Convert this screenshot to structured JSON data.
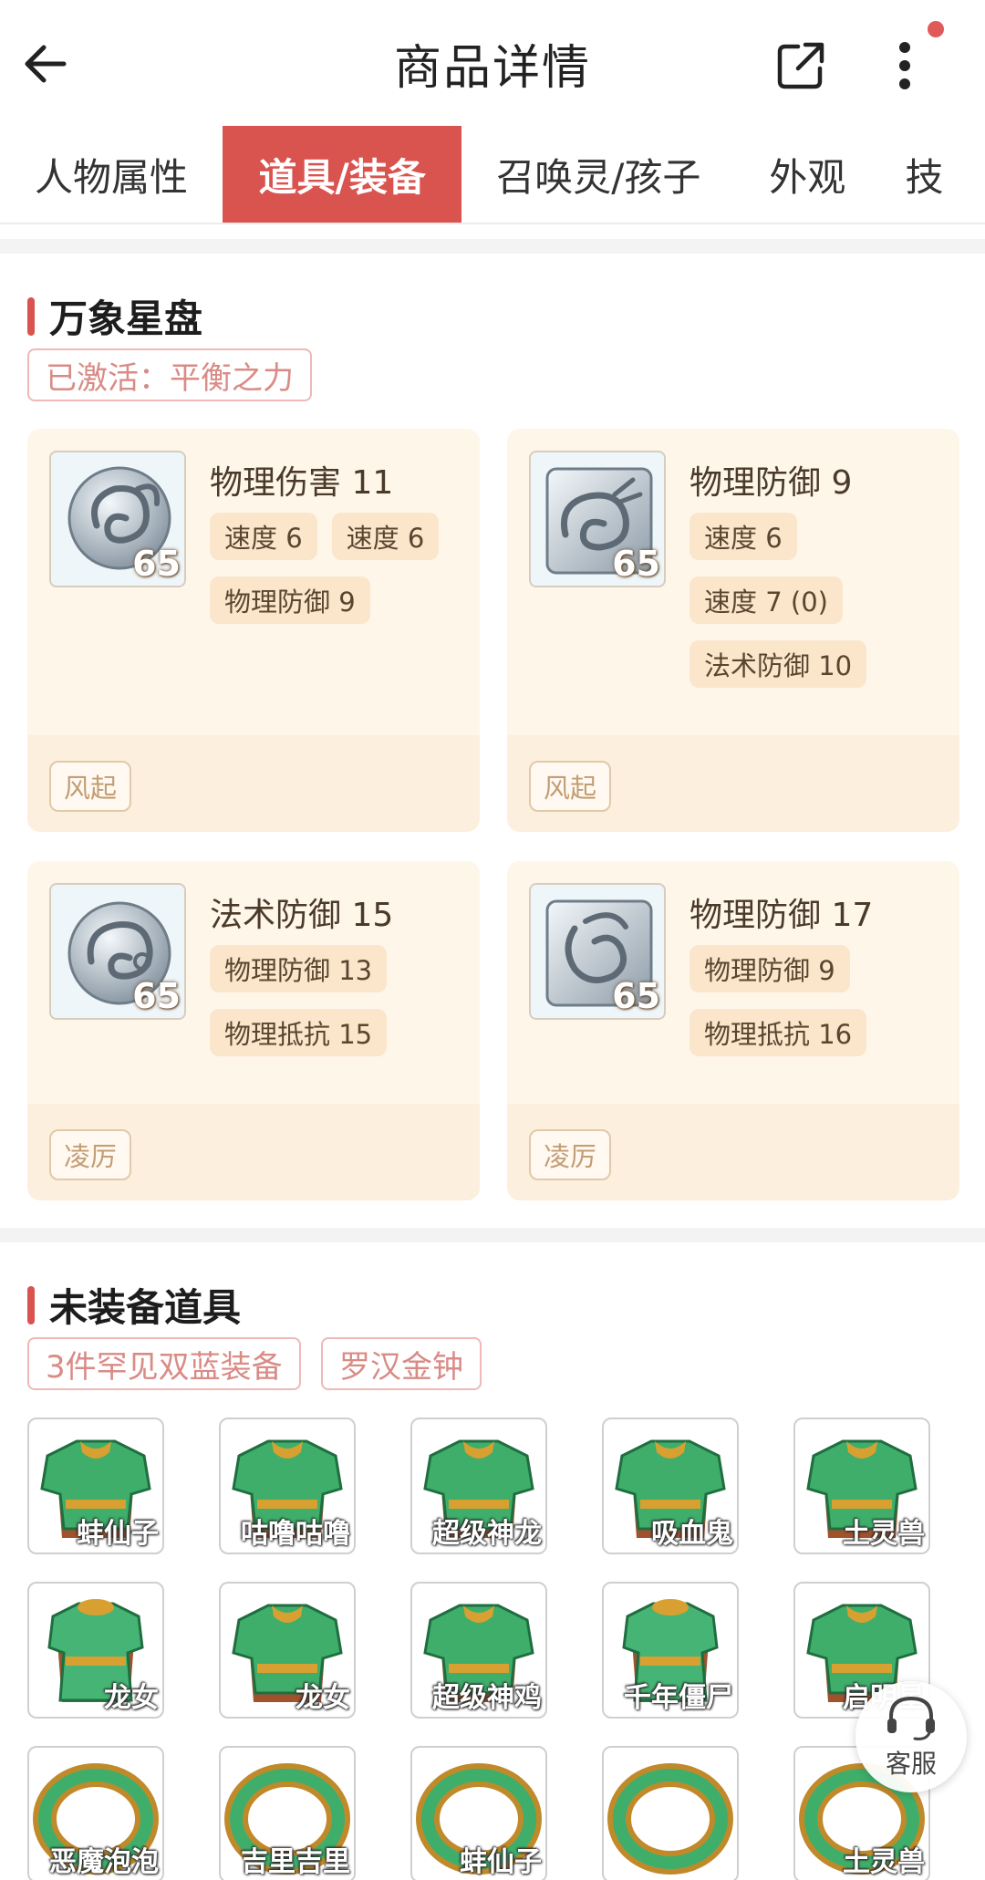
{
  "header": {
    "title": "商品详情",
    "back_icon": "arrow-left-icon",
    "share_icon": "share-external-icon",
    "more_icon": "more-vertical-icon",
    "notification_dot_color": "#e05a5a"
  },
  "tabs": [
    {
      "label": "人物属性",
      "active": false
    },
    {
      "label": "道具/装备",
      "active": true
    },
    {
      "label": "召唤灵/孩子",
      "active": false
    },
    {
      "label": "外观",
      "active": false
    },
    {
      "label": "技",
      "active": false
    }
  ],
  "star_disc": {
    "title": "万象星盘",
    "activated": "已激活：平衡之力",
    "cards": [
      {
        "icon": "silver-ram-emblem-icon",
        "level": "65",
        "main_attr": "物理伤害 11",
        "sub_attrs": [
          "速度 6",
          "速度 6",
          "物理防御 9"
        ],
        "suit": "风起"
      },
      {
        "icon": "silver-dragon-emblem-icon",
        "level": "65",
        "main_attr": "物理防御 9",
        "sub_attrs": [
          "速度 6",
          "速度 7 (0)",
          "法术防御 10"
        ],
        "suit": "风起"
      },
      {
        "icon": "silver-ox-emblem-icon",
        "level": "65",
        "main_attr": "法术防御 15",
        "sub_attrs": [
          "物理防御 13",
          "物理抵抗 15"
        ],
        "suit": "凌厉"
      },
      {
        "icon": "silver-goat-emblem-icon",
        "level": "65",
        "main_attr": "物理防御 17",
        "sub_attrs": [
          "物理防御 9",
          "物理抵抗 16"
        ],
        "suit": "凌厉"
      }
    ]
  },
  "unequipped": {
    "title": "未装备道具",
    "tags": [
      "3件罕见双蓝装备",
      "罗汉金钟"
    ],
    "rows": [
      [
        {
          "icon": "green-armor-icon",
          "label": "蚌仙子"
        },
        {
          "icon": "green-armor-icon",
          "label": "咕噜咕噜"
        },
        {
          "icon": "green-armor-icon",
          "label": "超级神龙"
        },
        {
          "icon": "green-armor-icon",
          "label": "吸血鬼"
        },
        {
          "icon": "green-armor-icon",
          "label": "土灵兽"
        }
      ],
      [
        {
          "icon": "green-robe-icon",
          "label": "龙女"
        },
        {
          "icon": "green-armor-icon",
          "label": "龙女"
        },
        {
          "icon": "green-armor-icon",
          "label": "超级神鸡"
        },
        {
          "icon": "green-robe-icon",
          "label": "千年僵尸"
        },
        {
          "icon": "green-armor-icon",
          "label": "启明星"
        }
      ],
      [
        {
          "icon": "jade-ring-icon",
          "label": "恶魔泡泡"
        },
        {
          "icon": "jade-ring-icon",
          "label": "吉里吉里"
        },
        {
          "icon": "jade-ring-icon",
          "label": "蚌仙子"
        },
        {
          "icon": "jade-ring-icon",
          "label": ""
        },
        {
          "icon": "jade-ring-icon",
          "label": "土灵兽"
        }
      ]
    ]
  },
  "customer_service": {
    "label": "客服",
    "icon": "headset-icon"
  }
}
